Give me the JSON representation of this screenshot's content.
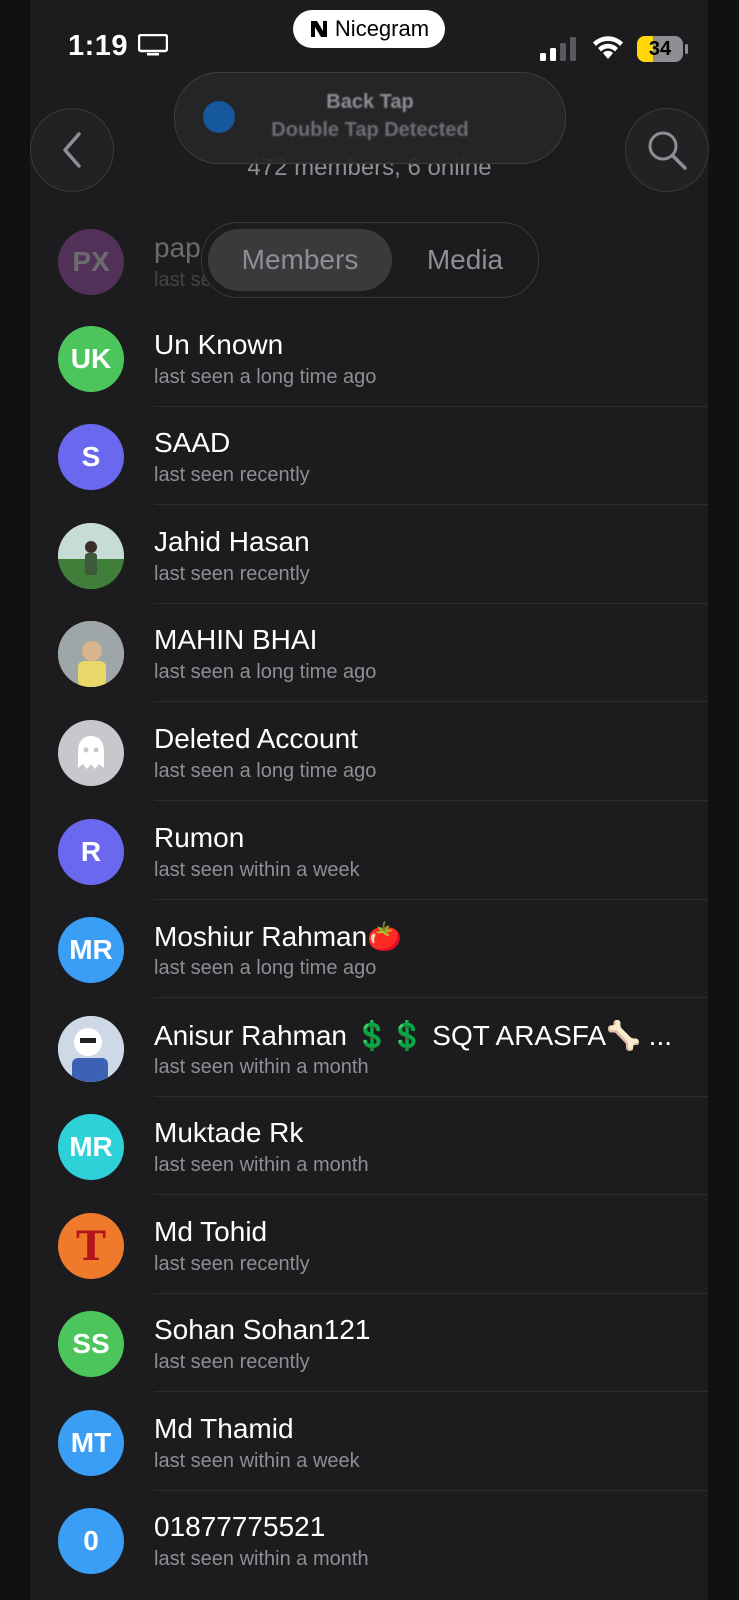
{
  "status_bar": {
    "time": "1:19",
    "app_name": "Nicegram",
    "battery": "34"
  },
  "header": {
    "toast_title": "Back Tap",
    "toast_subtitle": "Double Tap Detected",
    "member_count": "472 members, 6 online"
  },
  "tabs": [
    {
      "label": "Members",
      "selected": true
    },
    {
      "label": "Media",
      "selected": false
    }
  ],
  "members": [
    {
      "initials": "PX",
      "name": "pap",
      "status": "last se",
      "color": "#b659c8"
    },
    {
      "initials": "UK",
      "name": "Un Known",
      "status": "last seen a long time ago",
      "color": "#4cc55d"
    },
    {
      "initials": "S",
      "name": "SAAD",
      "status": "last seen recently",
      "color": "#6b68f0"
    },
    {
      "initials": "",
      "name": "Jahid Hasan",
      "status": "last seen recently",
      "color": "#5b9a4c"
    },
    {
      "initials": "",
      "name": "MAHIN BHAI",
      "status": "last seen a long time ago",
      "color": "#b8b08a"
    },
    {
      "initials": "",
      "name": "Deleted Account",
      "status": "last seen a long time ago",
      "color": "#c7c7cc"
    },
    {
      "initials": "R",
      "name": "Rumon",
      "status": "last seen within a week",
      "color": "#6b68f0"
    },
    {
      "initials": "MR",
      "name": "Moshiur Rahman🍅",
      "status": "last seen a long time ago",
      "color": "#3a9ef5"
    },
    {
      "initials": "",
      "name": "Anisur Rahman 💲💲 SQT ARASFA🦴 ...",
      "status": "last seen within a month",
      "color": "#cfd8e6"
    },
    {
      "initials": "MR",
      "name": "Muktade Rk",
      "status": "last seen within a month",
      "color": "#2ed1d8"
    },
    {
      "initials": "T",
      "name": "Md Tohid",
      "status": "last seen recently",
      "color": "#f07a2c"
    },
    {
      "initials": "SS",
      "name": "Sohan Sohan121",
      "status": "last seen recently",
      "color": "#4cc55d"
    },
    {
      "initials": "MT",
      "name": "Md Thamid",
      "status": "last seen within a week",
      "color": "#3a9ef5"
    },
    {
      "initials": "0",
      "name": "01877775521",
      "status": "last seen within a month",
      "color": "#3a9ef5"
    }
  ]
}
